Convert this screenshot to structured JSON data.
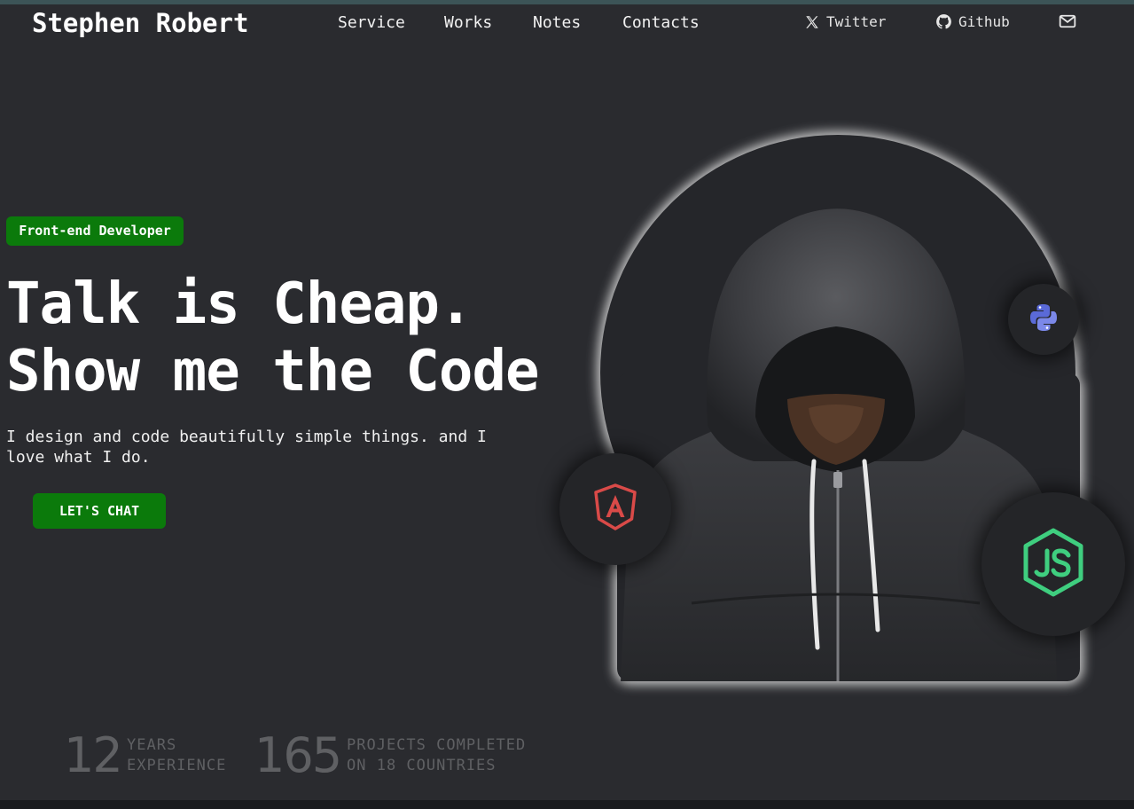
{
  "header": {
    "brand": "Stephen Robert",
    "nav": [
      "Service",
      "Works",
      "Notes",
      "Contacts"
    ],
    "social": {
      "twitter_label": "Twitter",
      "github_label": "Github"
    }
  },
  "hero": {
    "role": "Front-end Developer",
    "headline_line1": "Talk is Cheap.",
    "headline_line2": "Show me the Code",
    "tagline": "I design and code beautifully simple things. and I love what I do.",
    "cta_label": "LET'S CHAT",
    "tech_icons": [
      "python-icon",
      "angular-icon",
      "nodejs-icon"
    ]
  },
  "stats": [
    {
      "number": "12",
      "line1": "YEARS",
      "line2": "EXPERIENCE"
    },
    {
      "number": "165",
      "line1": "PROJECTS COMPLETED",
      "line2": "ON 18 COUNTRIES"
    }
  ],
  "colors": {
    "background": "#2a2b2f",
    "accent": "#0b7a0b",
    "muted_text": "#5f6063"
  }
}
